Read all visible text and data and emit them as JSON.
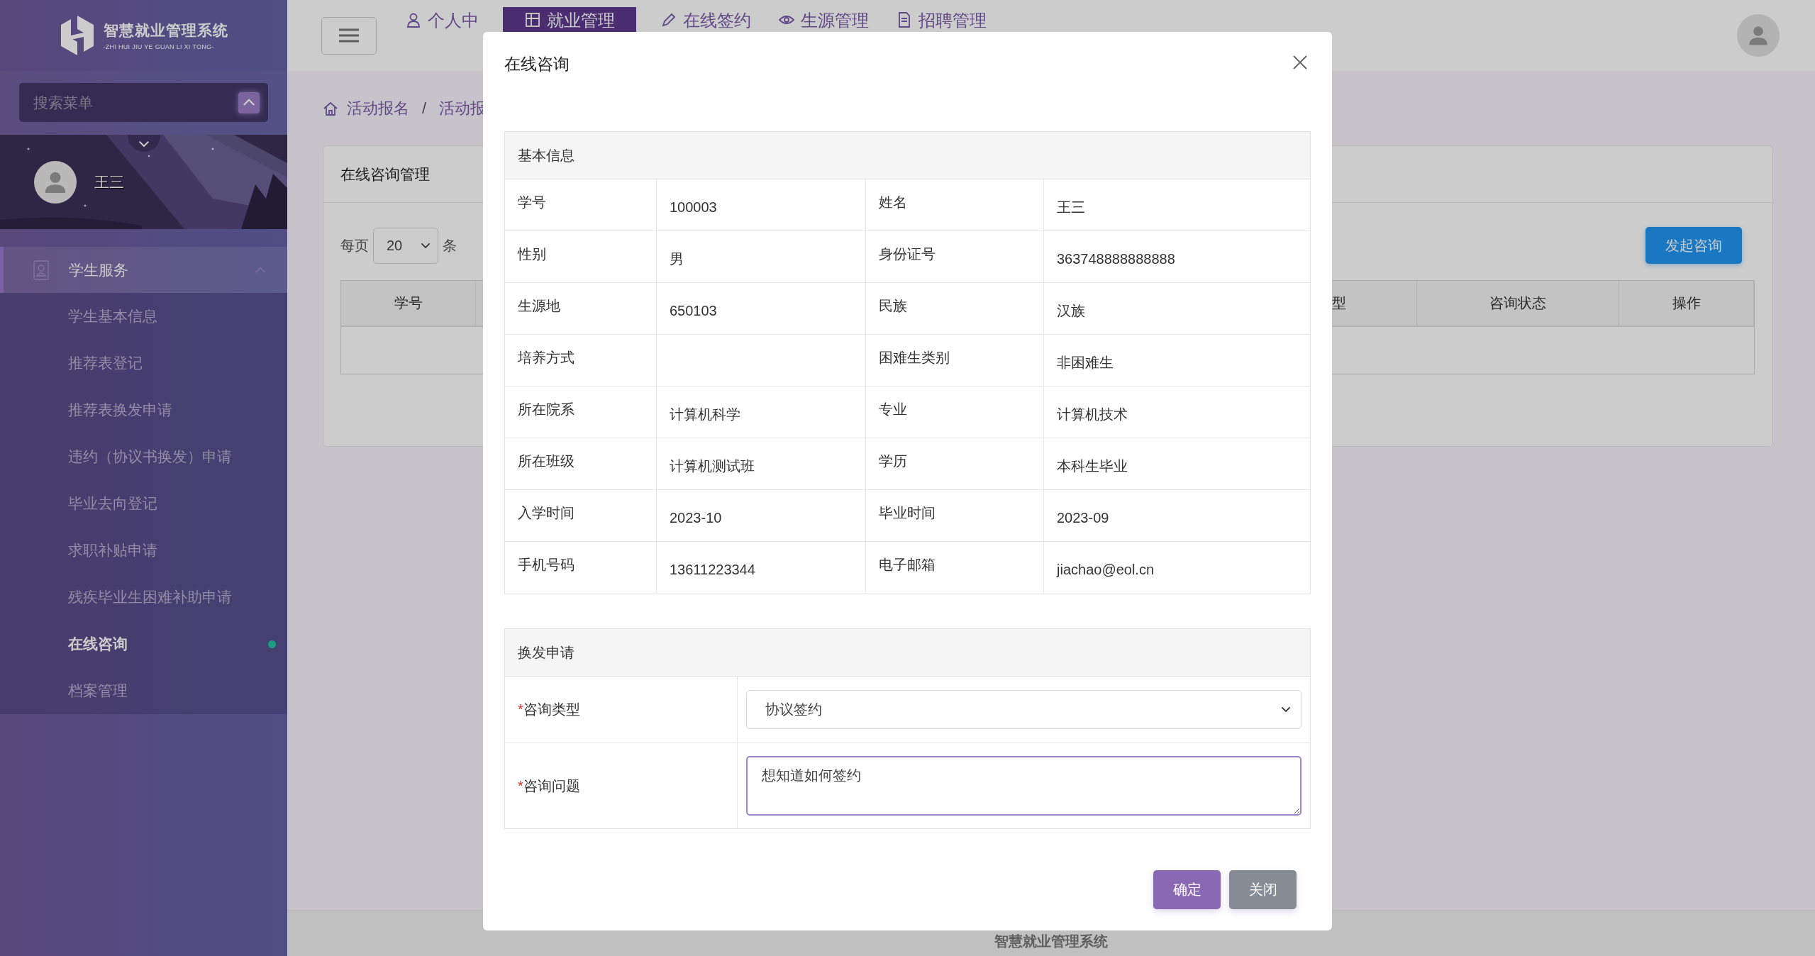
{
  "sidebar": {
    "logo": {
      "title": "智慧就业管理系统",
      "subtitle": "-ZHI HUI JIU YE GUAN LI XI TONG-"
    },
    "search": {
      "placeholder": "搜索菜单"
    },
    "user": {
      "name": "王三"
    },
    "menu": [
      {
        "label": "学生服务",
        "expanded": true,
        "children": [
          {
            "label": "学生基本信息",
            "selected": false
          },
          {
            "label": "推荐表登记",
            "selected": false
          },
          {
            "label": "推荐表换发申请",
            "selected": false
          },
          {
            "label": "违约（协议书换发）申请",
            "selected": false
          },
          {
            "label": "毕业去向登记",
            "selected": false
          },
          {
            "label": "求职补贴申请",
            "selected": false
          },
          {
            "label": "残疾毕业生困难补助申请",
            "selected": false
          },
          {
            "label": "在线咨询",
            "selected": true
          },
          {
            "label": "档案管理",
            "selected": false
          }
        ]
      }
    ]
  },
  "top_nav": {
    "tabs": [
      {
        "label": "个人中",
        "selected": false
      },
      {
        "label": "就业管理",
        "selected": true
      },
      {
        "label": "在线签约",
        "selected": false
      },
      {
        "label": "生源管理",
        "selected": false
      },
      {
        "label": "招聘管理",
        "selected": false
      }
    ]
  },
  "breadcrumb": {
    "separator": "/",
    "items": [
      "活动报名",
      "活动报"
    ]
  },
  "card": {
    "title": "在线咨询管理",
    "page_size": {
      "prefix": "每页",
      "value": "20",
      "suffix": "条"
    },
    "action_button": "发起咨询",
    "table": {
      "columns": [
        "学号",
        "",
        "型",
        "咨询状态",
        "操作"
      ]
    }
  },
  "footer": "智慧就业管理系统",
  "dialog": {
    "title": "在线咨询",
    "info": {
      "title": "基本信息",
      "rows": [
        [
          {
            "label": "学号",
            "value": "100003"
          },
          {
            "label": "姓名",
            "value": "王三"
          }
        ],
        [
          {
            "label": "性别",
            "value": "男"
          },
          {
            "label": "身份证号",
            "value": "363748888888888"
          }
        ],
        [
          {
            "label": "生源地",
            "value": "650103"
          },
          {
            "label": "民族",
            "value": "汉族"
          }
        ],
        [
          {
            "label": "培养方式"
          },
          {
            "label": "困难生类别",
            "value": "非困难生"
          }
        ],
        [
          {
            "label": "所在院系",
            "value": "计算机科学"
          },
          {
            "label": "专业",
            "value": "计算机技术"
          }
        ],
        [
          {
            "label": "所在班级",
            "value": "计算机测试班"
          },
          {
            "label": "学历",
            "value": "本科生毕业"
          }
        ],
        [
          {
            "label": "入学时间",
            "value": "2023-10"
          },
          {
            "label": "毕业时间",
            "value": "2023-09"
          }
        ],
        [
          {
            "label": "手机号码",
            "value": "13611223344"
          },
          {
            "label": "电子邮箱",
            "value": "jiachao@eol.cn"
          }
        ]
      ]
    },
    "form": {
      "title": "换发申请",
      "fields": [
        {
          "label": "咨询类型",
          "required_mark": "*",
          "kind": "select",
          "value": "协议签约"
        },
        {
          "label": "咨询问题",
          "required_mark": "*",
          "kind": "textarea",
          "value": "想知道如何签约"
        }
      ]
    },
    "buttons": [
      {
        "label": "确定",
        "kind": "primary"
      },
      {
        "label": "关闭",
        "kind": "secondary"
      }
    ]
  }
}
